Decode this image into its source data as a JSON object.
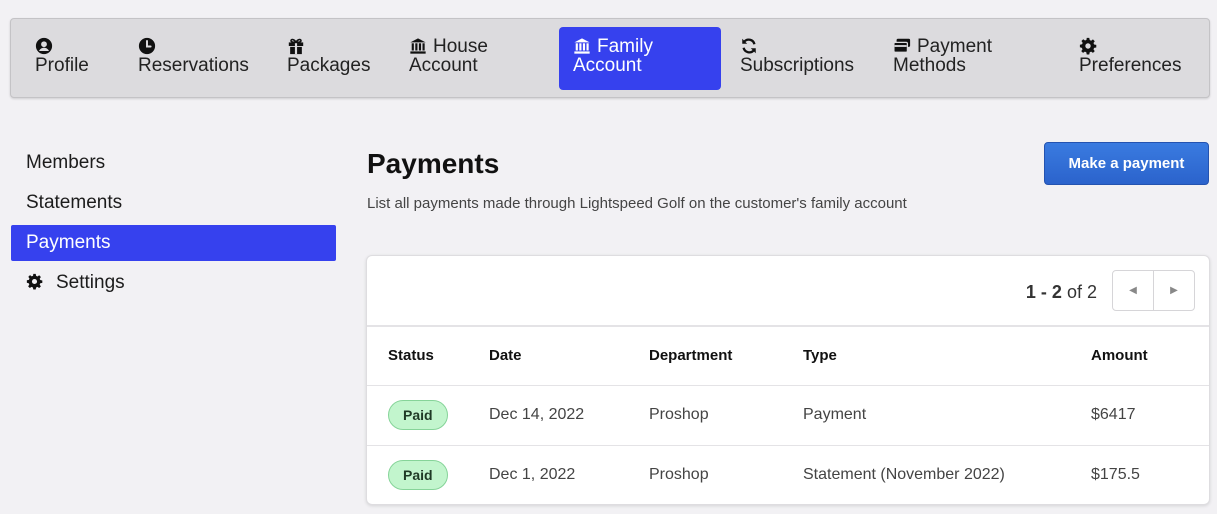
{
  "topnav": {
    "tabs": [
      {
        "l1": "",
        "l2": "Profile",
        "icon": "user-circle-icon"
      },
      {
        "l1": "",
        "l2": "Reservations",
        "icon": "clock-icon"
      },
      {
        "l1": "",
        "l2": "Packages",
        "icon": "gift-icon"
      },
      {
        "l1": "House",
        "l2": "Account",
        "icon": "bank-icon"
      },
      {
        "l1": "Family",
        "l2": "Account",
        "icon": "bank-icon",
        "active": true
      },
      {
        "l1": "",
        "l2": "Subscriptions",
        "icon": "sync-icon"
      },
      {
        "l1": "Payment",
        "l2": "Methods",
        "icon": "credit-card-icon"
      },
      {
        "l1": "",
        "l2": "Preferences",
        "icon": "gear-icon"
      }
    ]
  },
  "sidenav": {
    "items": [
      {
        "label": "Members"
      },
      {
        "label": "Statements"
      },
      {
        "label": "Payments",
        "active": true
      },
      {
        "label": "Settings",
        "icon": "gear-icon"
      }
    ]
  },
  "main": {
    "title": "Payments",
    "description": "List all payments made through Lightspeed Golf on the customer's family account",
    "make_payment_label": "Make a payment"
  },
  "pager": {
    "range": "1 - 2",
    "of_text": "of 2"
  },
  "table": {
    "headers": [
      "Status",
      "Date",
      "Department",
      "Type",
      "Amount"
    ],
    "rows": [
      {
        "status": "Paid",
        "date": "Dec 14, 2022",
        "department": "Proshop",
        "type": "Payment",
        "amount": "$6417"
      },
      {
        "status": "Paid",
        "date": "Dec 1, 2022",
        "department": "Proshop",
        "type": "Statement (November 2022)",
        "amount": "$175.5"
      }
    ]
  },
  "colors": {
    "accent": "#3641ee",
    "button": "#2f6ed8",
    "badge_bg": "#c2f5cd",
    "page_bg": "#f2f1f4"
  }
}
